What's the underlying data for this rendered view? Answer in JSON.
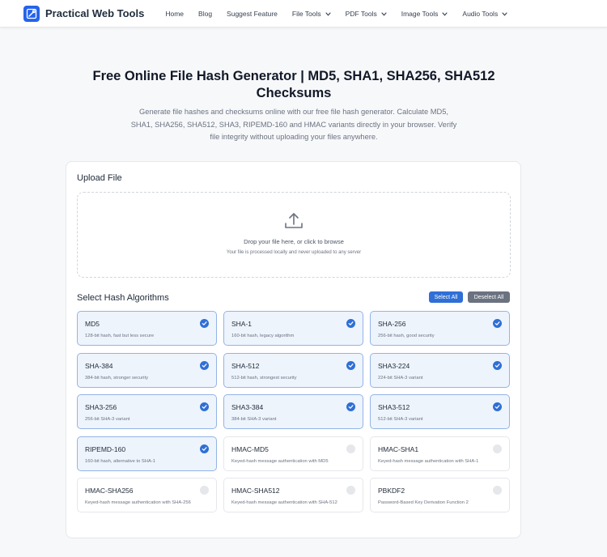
{
  "header": {
    "brand": "Practical Web Tools",
    "nav": [
      {
        "label": "Home",
        "dropdown": false
      },
      {
        "label": "Blog",
        "dropdown": false
      },
      {
        "label": "Suggest Feature",
        "dropdown": false
      },
      {
        "label": "File Tools",
        "dropdown": true
      },
      {
        "label": "PDF Tools",
        "dropdown": true
      },
      {
        "label": "Image Tools",
        "dropdown": true
      },
      {
        "label": "Audio Tools",
        "dropdown": true
      }
    ]
  },
  "hero": {
    "title_line1": "Free Online File Hash Generator | MD5, SHA1, SHA256, SHA512",
    "title_line2": "Checksums",
    "subtitle_line1": "Generate file hashes and checksums online with our free file hash generator. Calculate MD5,",
    "subtitle_line2": "SHA1, SHA256, SHA512, SHA3, RIPEMD-160 and HMAC variants directly in your browser. Verify",
    "subtitle_line3": "file integrity without uploading your files anywhere."
  },
  "upload": {
    "section_title": "Upload File",
    "drop_text": "Drop your file here, or click to browse",
    "drop_subtext": "Your file is processed locally and never uploaded to any server"
  },
  "algorithms": {
    "section_title": "Select Hash Algorithms",
    "select_all_label": "Select All",
    "deselect_all_label": "Deselect All",
    "items": [
      {
        "name": "MD5",
        "desc": "128-bit hash, fast but less secure",
        "selected": true
      },
      {
        "name": "SHA-1",
        "desc": "160-bit hash, legacy algorithm",
        "selected": true
      },
      {
        "name": "SHA-256",
        "desc": "256-bit hash, good security",
        "selected": true
      },
      {
        "name": "SHA-384",
        "desc": "384-bit hash, stronger security",
        "selected": true
      },
      {
        "name": "SHA-512",
        "desc": "512-bit hash, strongest security",
        "selected": true
      },
      {
        "name": "SHA3-224",
        "desc": "224-bit SHA-3 variant",
        "selected": true
      },
      {
        "name": "SHA3-256",
        "desc": "256-bit SHA-3 variant",
        "selected": true
      },
      {
        "name": "SHA3-384",
        "desc": "384-bit SHA-3 variant",
        "selected": true
      },
      {
        "name": "SHA3-512",
        "desc": "512-bit SHA-3 variant",
        "selected": true
      },
      {
        "name": "RIPEMD-160",
        "desc": "160-bit hash, alternative to SHA-1",
        "selected": true
      },
      {
        "name": "HMAC-MD5",
        "desc": "Keyed-hash message authentication with MD5",
        "selected": false
      },
      {
        "name": "HMAC-SHA1",
        "desc": "Keyed-hash message authentication with SHA-1",
        "selected": false
      },
      {
        "name": "HMAC-SHA256",
        "desc": "Keyed-hash message authentication with SHA-256",
        "selected": false
      },
      {
        "name": "HMAC-SHA512",
        "desc": "Keyed-hash message authentication with SHA-512",
        "selected": false
      },
      {
        "name": "PBKDF2",
        "desc": "Password-Based Key Derivation Function 2",
        "selected": false
      }
    ]
  },
  "colors": {
    "accent": "#2f6fd6",
    "selected_bg": "#eef4fc",
    "selected_border": "#93b4e6",
    "secondary_button": "#6b7280"
  },
  "icons": {
    "brand_logo": "tools-logo-icon",
    "dropdown": "chevron-down-icon",
    "upload": "upload-icon",
    "checked": "check-circle-icon",
    "unchecked": "empty-circle-icon"
  }
}
